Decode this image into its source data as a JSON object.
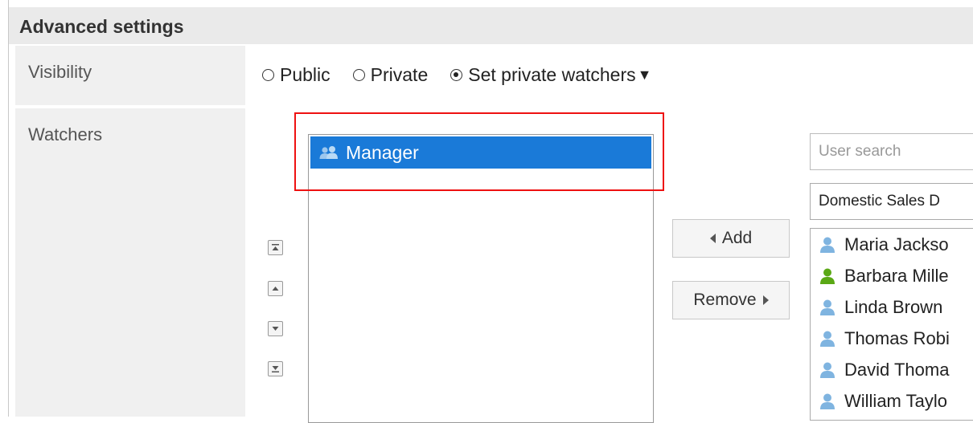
{
  "header": {
    "title": "Advanced settings"
  },
  "rows": {
    "visibility_label": "Visibility",
    "watchers_label": "Watchers"
  },
  "visibility": {
    "options": [
      {
        "label": "Public",
        "checked": false
      },
      {
        "label": "Private",
        "checked": false
      },
      {
        "label": "Set private watchers",
        "checked": true
      }
    ],
    "dropdown_arrow": "▼"
  },
  "watchers": {
    "selected_item": "Manager",
    "selected_icon": "group-icon"
  },
  "order_buttons": [
    "move-to-top-icon",
    "move-up-icon",
    "move-down-icon",
    "move-to-bottom-icon"
  ],
  "actions": {
    "add_label": "Add",
    "remove_label": "Remove"
  },
  "user_search": {
    "placeholder": "User search",
    "department": "Domestic Sales D"
  },
  "users": [
    {
      "name": "Maria Jackso",
      "icon_color": "#7fb4e0"
    },
    {
      "name": "Barbara Mille",
      "icon_color": "#5aa815"
    },
    {
      "name": "Linda Brown",
      "icon_color": "#7fb4e0"
    },
    {
      "name": "Thomas Robi",
      "icon_color": "#7fb4e0"
    },
    {
      "name": "David Thoma",
      "icon_color": "#7fb4e0"
    },
    {
      "name": "William Taylo",
      "icon_color": "#7fb4e0"
    }
  ],
  "colors": {
    "selection": "#1a7ad8",
    "highlight_box": "#e11111"
  }
}
